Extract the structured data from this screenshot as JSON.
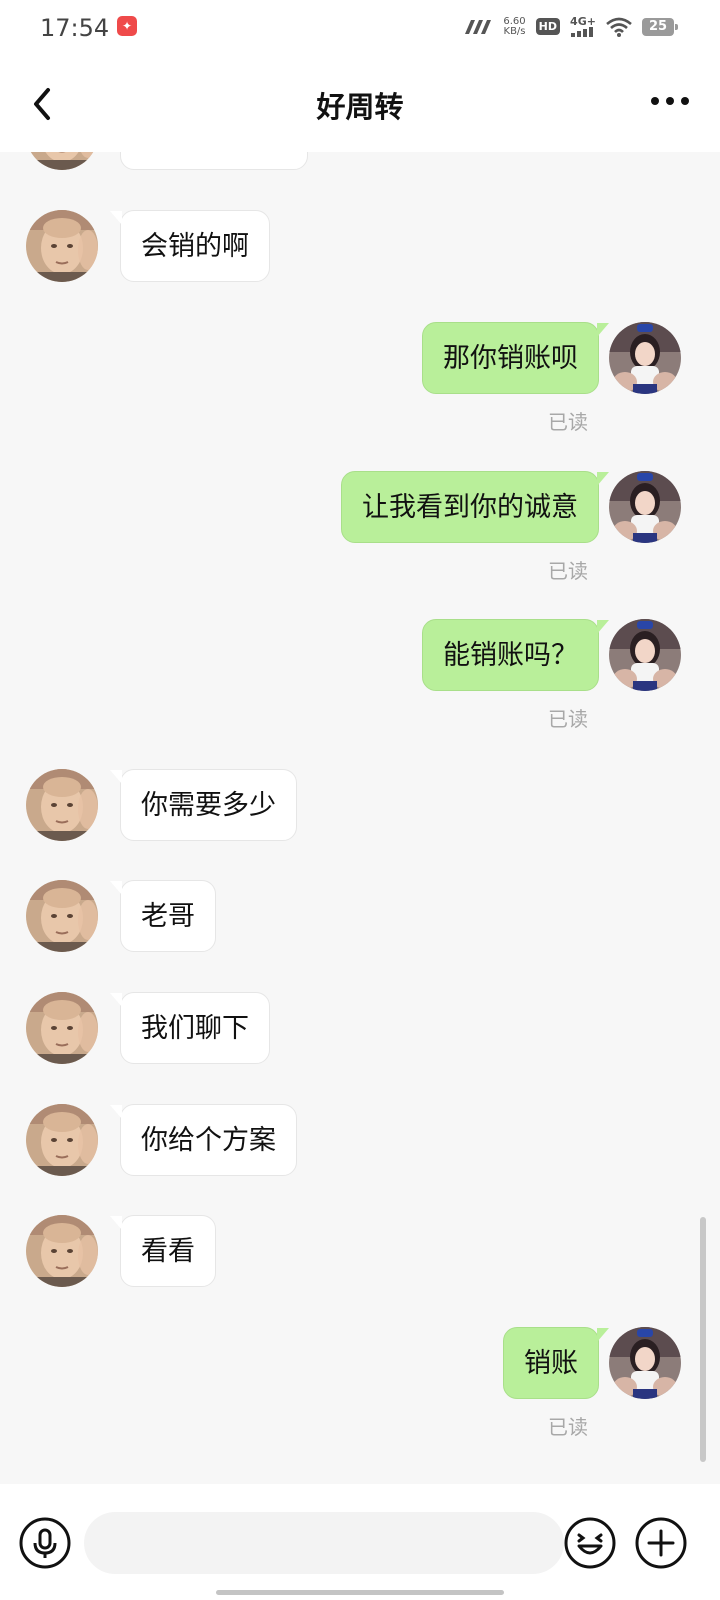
{
  "status_bar": {
    "time": "17:54",
    "speed_value": "6.60",
    "speed_unit": "KB/s",
    "hd": "HD",
    "network": "4G+",
    "battery": "25"
  },
  "header": {
    "title": "好周转"
  },
  "messages": [
    {
      "side": "in",
      "text": ""
    },
    {
      "side": "in",
      "text": "会销的啊"
    },
    {
      "side": "out",
      "text": "那你销账呗",
      "read": "已读"
    },
    {
      "side": "out",
      "text": "让我看到你的诚意",
      "read": "已读"
    },
    {
      "side": "out",
      "text": "能销账吗？",
      "read": "已读"
    },
    {
      "side": "in",
      "text": "你需要多少"
    },
    {
      "side": "in",
      "text": "老哥"
    },
    {
      "side": "in",
      "text": "我们聊下"
    },
    {
      "side": "in",
      "text": "你给个方案"
    },
    {
      "side": "in",
      "text": "看看"
    },
    {
      "side": "out",
      "text": "销账",
      "read": "已读"
    }
  ],
  "input": {
    "placeholder": ""
  },
  "colors": {
    "outgoing_bubble": "#b9ef9a",
    "incoming_bubble": "#ffffff",
    "background": "#f7f7f7"
  }
}
